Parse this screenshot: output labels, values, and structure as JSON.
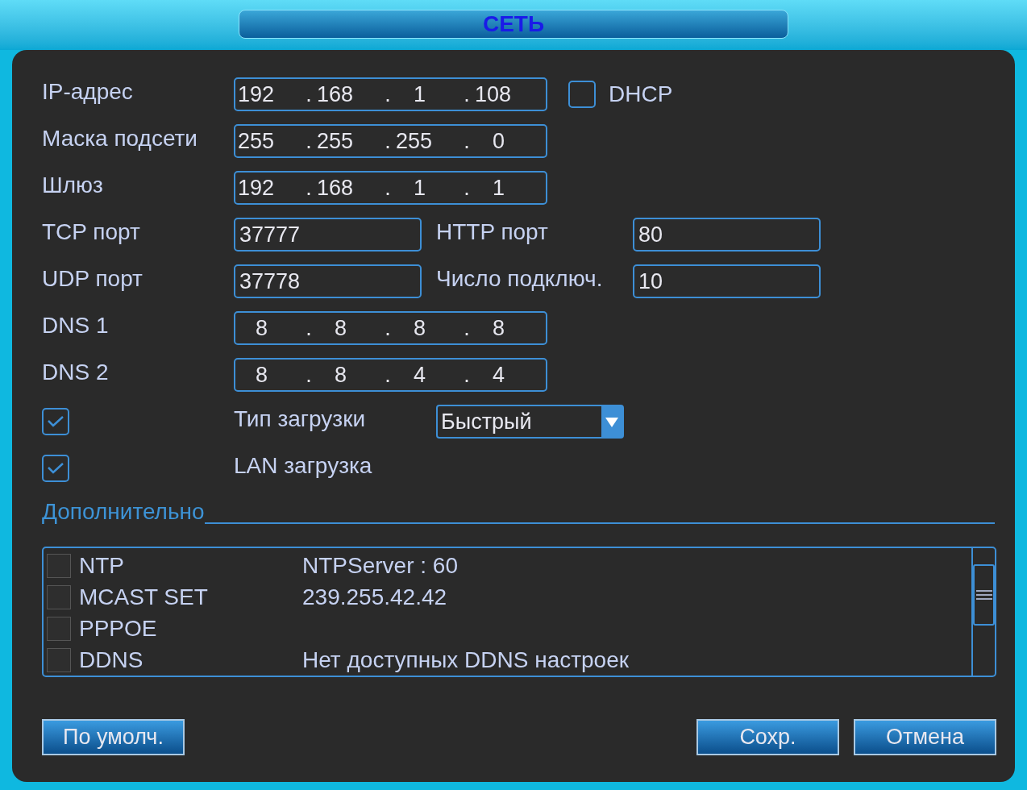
{
  "window": {
    "title": "СЕТЬ"
  },
  "address_rows": [
    {
      "kind": "ip",
      "label": "IP-адрес",
      "octets": [
        "192",
        "168",
        "1",
        "108"
      ],
      "separators": [
        ".",
        ".",
        "."
      ],
      "dhcp": {
        "label": "DHCP",
        "checked": false
      }
    },
    {
      "kind": "ip",
      "label": "Маска подсети",
      "octets": [
        "255",
        "255",
        "255",
        "0"
      ],
      "separators": [
        ".",
        ".",
        "."
      ]
    },
    {
      "kind": "ip",
      "label": "Шлюз",
      "octets": [
        "192",
        "168",
        "1",
        "1"
      ],
      "separators": [
        ".",
        ".",
        "."
      ]
    },
    {
      "kind": "ports",
      "label": "TCP порт",
      "value": "37777",
      "label_2": "HTTP порт",
      "value_2": "80"
    },
    {
      "kind": "ports",
      "label": "UDP порт",
      "value": "37778",
      "label_2": "Число подключ.",
      "value_2": "10"
    },
    {
      "kind": "ip",
      "label": "DNS 1",
      "octets": [
        "8",
        "8",
        "8",
        "8"
      ],
      "separators": [
        ".",
        ".",
        "."
      ]
    },
    {
      "kind": "ip",
      "label": "DNS 2",
      "octets": [
        "8",
        "8",
        "4",
        "4"
      ],
      "separators": [
        ".",
        ".",
        "."
      ]
    }
  ],
  "option_rows": [
    {
      "checked": true,
      "label": "Тип загрузки",
      "dropdown": {
        "value": "Быстрый"
      }
    },
    {
      "checked": true,
      "label": "LAN загрузка"
    }
  ],
  "advanced": {
    "title": "Дополнительно",
    "items": [
      {
        "name": "NTP",
        "value": "NTPServer : 60",
        "checked": false
      },
      {
        "name": "MCAST SET",
        "value": "239.255.42.42",
        "checked": false
      },
      {
        "name": "PPPOE",
        "checked": false
      },
      {
        "name": "DDNS",
        "value": "Нет доступных DDNS настроек",
        "checked": false
      }
    ]
  },
  "buttons": {
    "left": [
      "По умолч."
    ],
    "right": [
      "Сохр.",
      "Отмена"
    ]
  }
}
